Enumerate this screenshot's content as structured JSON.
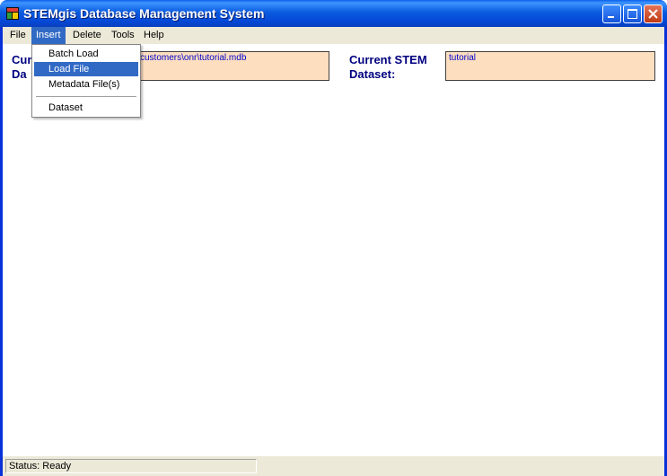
{
  "window": {
    "title": "STEMgis Database Management System"
  },
  "menubar": {
    "items": [
      "File",
      "Insert",
      "Delete",
      "Tools",
      "Help"
    ],
    "active": "Insert"
  },
  "insert_menu": {
    "items": [
      "Batch Load",
      "Load File",
      "Metadata File(s)",
      "Dataset"
    ],
    "highlighted": "Load File"
  },
  "main": {
    "db_label_line1": "Cur",
    "db_label_line2": "Da",
    "db_value": "customers\\onr\\tutorial.mdb",
    "stem_label_line1": "Current STEM",
    "stem_label_line2": "Dataset:",
    "stem_value": "tutorial"
  },
  "status": {
    "text": "Status: Ready"
  },
  "colors": {
    "field_bg": "#FDDFC0",
    "label": "#000080",
    "field_text": "#0000CC",
    "highlight": "#316AC5"
  }
}
